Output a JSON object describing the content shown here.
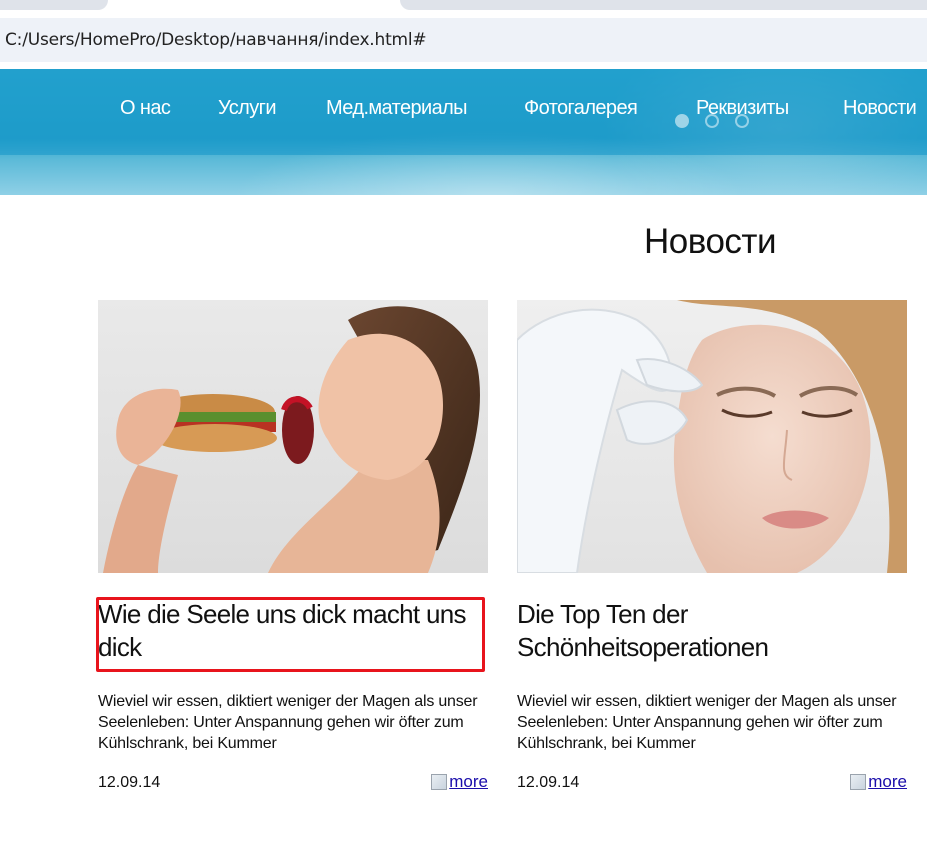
{
  "browser": {
    "address": "C:/Users/HomePro/Desktop/навчання/index.html#"
  },
  "nav": {
    "items": [
      {
        "label": "О нас"
      },
      {
        "label": "Услуги"
      },
      {
        "label": "Мед.материалы"
      },
      {
        "label": "Фотогалерея"
      },
      {
        "label": "Реквизиты"
      },
      {
        "label": "Новости"
      }
    ],
    "slider_dots": 3
  },
  "main": {
    "title": "Новости",
    "articles": [
      {
        "image": "woman-eating-burger-photo",
        "title": "Wie die Seele uns dick macht uns dick",
        "text": "Wieviel wir essen, diktiert weniger der Magen als unser Seelenleben: Unter Anspannung gehen wir öfter zum Kühlschrank, bei Kummer",
        "date": "12.09.14",
        "more_label": "more"
      },
      {
        "image": "gloved-hands-touching-face-photo",
        "title": "Die Top Ten der Schönheitsoperationen",
        "text": "Wieviel wir essen, diktiert weniger der Magen als unser Seelenleben: Unter Anspannung gehen wir öfter zum Kühlschrank, bei Kummer",
        "date": "12.09.14",
        "more_label": "more"
      }
    ]
  },
  "colors": {
    "nav_blue": "#2aa3cc",
    "highlight_red": "#e8141c",
    "link_blue": "#1a0dab"
  }
}
